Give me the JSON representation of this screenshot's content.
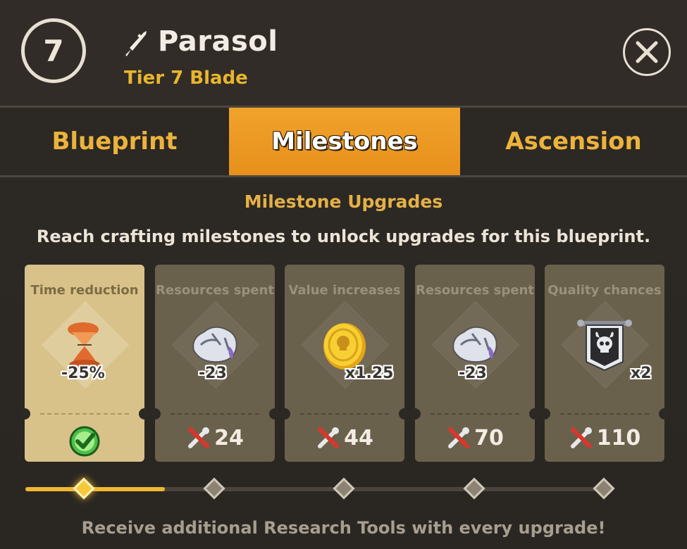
{
  "header": {
    "tier_number": "7",
    "item_name": "Parasol",
    "item_subtitle": "Tier 7 Blade",
    "weapon_icon": "blade-icon",
    "close_icon": "close-icon"
  },
  "tabs": [
    {
      "label": "Blueprint",
      "active": false
    },
    {
      "label": "Milestones",
      "active": true
    },
    {
      "label": "Ascension",
      "active": false
    }
  ],
  "section": {
    "title": "Milestone Upgrades",
    "description": "Reach crafting milestones to unlock upgrades for this blueprint."
  },
  "milestones": [
    {
      "label": "Time reduction",
      "icon": "hourglass-icon",
      "value": "-25%",
      "cost": "",
      "unlocked": true
    },
    {
      "label": "Resources spent",
      "icon": "ore-icon",
      "value": "-23",
      "cost": "24",
      "unlocked": false
    },
    {
      "label": "Value increases",
      "icon": "gold-coin-icon",
      "value": "x1.25",
      "cost": "44",
      "unlocked": false
    },
    {
      "label": "Resources spent",
      "icon": "ore-icon",
      "value": "-23",
      "cost": "70",
      "unlocked": false
    },
    {
      "label": "Quality chances",
      "icon": "banner-icon",
      "value": "x2",
      "cost": "110",
      "unlocked": false
    }
  ],
  "progress": {
    "completed_steps": 1,
    "total_steps": 5
  },
  "footer": "Receive additional Research Tools with every upgrade!",
  "colors": {
    "accent": "#ecb33c",
    "active_tab": "#f0a32a",
    "progress": "#f0b732"
  }
}
